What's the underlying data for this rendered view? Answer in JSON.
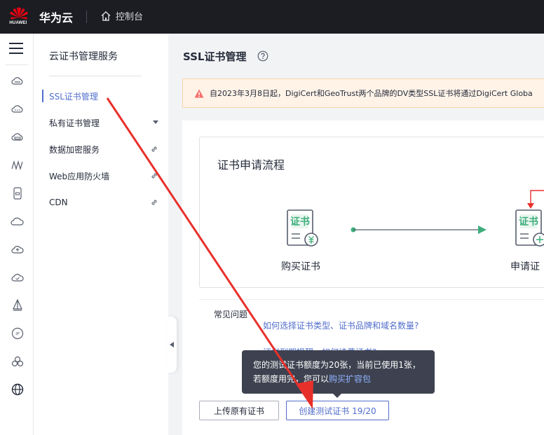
{
  "header": {
    "logo_text": "HUAWEI",
    "brand": "华为云",
    "console": "控制台"
  },
  "sidebar": {
    "title": "云证书管理服务",
    "items": [
      {
        "label": "SSL证书管理",
        "active": true
      },
      {
        "label": "私有证书管理",
        "trail": "chevron-down-icon"
      },
      {
        "label": "数据加密服务",
        "trail": "external-link-icon"
      },
      {
        "label": "Web应用防火墙",
        "trail": "external-link-icon"
      },
      {
        "label": "CDN",
        "trail": "external-link-icon"
      }
    ]
  },
  "main": {
    "page_title": "SSL证书管理",
    "notice": "自2023年3月8日起，DigiCert和GeoTrust两个品牌的DV类型SSL证书将通过DigiCert Globa",
    "flow": {
      "title": "证书申请流程",
      "steps": [
        {
          "icon_text": "证书",
          "label": "购买证书"
        },
        {
          "icon_text": "证书",
          "label": "申请证"
        }
      ]
    },
    "faq": {
      "title": "常见问题",
      "links": [
        "如何选择证书类型、证书品牌和域名数量?",
        "证书到期提醒，如何续费证书?"
      ]
    },
    "tooltip": {
      "line1": "您的测试证书额度为20张，当前已使用1张，",
      "line2_prefix": "若额度用完，您可以",
      "line2_link": "购买扩容包"
    },
    "buttons": {
      "upload": "上传原有证书",
      "create": "创建测试证书 19/20"
    }
  },
  "colors": {
    "accent": "#526ecc",
    "topbar": "#1b1d22",
    "annotation": "#e8302b",
    "success": "#3dae7b",
    "warning_bg": "#fff3e8"
  }
}
